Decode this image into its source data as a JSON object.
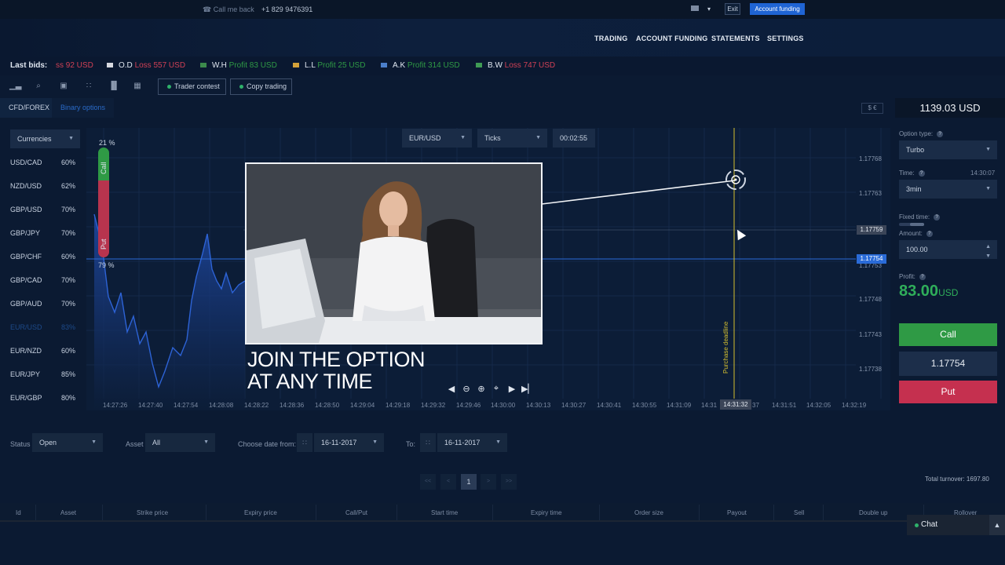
{
  "topbar": {
    "call_me_back": "Call me back",
    "phone": "+1 829 9476391",
    "exit_label": "Exit",
    "account_funding_label": "Account funding"
  },
  "nav": {
    "items": [
      "TRADING",
      "ACCOUNT FUNDING",
      "STATEMENTS",
      "SETTINGS"
    ]
  },
  "last_bids": {
    "label": "Last bids:",
    "items": [
      {
        "name": "",
        "result": "ss 92 USD",
        "type": "loss",
        "flag_color": "#5a6a82"
      },
      {
        "name": "O.D",
        "result": "Loss 557 USD",
        "type": "loss",
        "flag_color": "#d7d9e0"
      },
      {
        "name": "W.H",
        "result": "Profit 83 USD",
        "type": "profit",
        "flag_color": "#3c8a4c"
      },
      {
        "name": "L.L",
        "result": "Profit 25 USD",
        "type": "profit",
        "flag_color": "#d3a13a"
      },
      {
        "name": "A.K",
        "result": "Profit 314 USD",
        "type": "profit",
        "flag_color": "#4b7fcb"
      },
      {
        "name": "B.W",
        "result": "Loss 747 USD",
        "type": "loss",
        "flag_color": "#3f9b55"
      }
    ]
  },
  "toolbar": {
    "icons": [
      "chart-bar-icon",
      "search-chart-icon",
      "layout-icon",
      "indicator-icon",
      "bars-icon",
      "calendar-icon"
    ],
    "trader_contest": "Trader contest",
    "copy_trading": "Copy trading"
  },
  "tabs": {
    "cfd": "CFD/FOREX",
    "binary": "Binary options",
    "currency_switch": "$ €",
    "balance": "1139.03 USD"
  },
  "currencies": {
    "select": "Currencies",
    "pairs": [
      {
        "name": "USD/CAD",
        "pct": "60%"
      },
      {
        "name": "NZD/USD",
        "pct": "62%"
      },
      {
        "name": "GBP/USD",
        "pct": "70%"
      },
      {
        "name": "GBP/JPY",
        "pct": "70%"
      },
      {
        "name": "GBP/CHF",
        "pct": "60%"
      },
      {
        "name": "GBP/CAD",
        "pct": "70%"
      },
      {
        "name": "GBP/AUD",
        "pct": "70%"
      },
      {
        "name": "EUR/USD",
        "pct": "83%",
        "dim": true
      },
      {
        "name": "EUR/NZD",
        "pct": "60%"
      },
      {
        "name": "EUR/JPY",
        "pct": "85%"
      },
      {
        "name": "EUR/GBP",
        "pct": "80%"
      }
    ]
  },
  "chart": {
    "asset": "EUR/USD",
    "mode": "Ticks",
    "timer": "00:02:55",
    "call_pct": "21 %",
    "put_pct": "79 %",
    "call_label": "Call",
    "put_label": "Put",
    "price_labels": [
      "1.17768",
      "1.17763",
      "1.17753",
      "1.17748",
      "1.17743",
      "1.17738"
    ],
    "price_tag_grey": "1.17759",
    "price_tag_blue": "1.17754",
    "time_labels": [
      "14:27:26",
      "14:27:40",
      "14:27:54",
      "14:28:08",
      "14:28:22",
      "14:28:36",
      "14:28:50",
      "14:29:04",
      "14:29:18",
      "14:29:32",
      "14:29:46",
      "14:30:00",
      "14:30:13",
      "14:30:27",
      "14:30:41",
      "14:30:55",
      "14:31:09",
      "14:31",
      "37",
      "14:31:51",
      "14:32:05",
      "14:32:19"
    ],
    "time_highlight": "14:31:32",
    "deadline_label": "Purchase deadline",
    "colors": {
      "deadline": "#d4bf2f",
      "area": "#1b3f8c",
      "blue_line": "#2a6bd8"
    }
  },
  "video": {
    "caption_line1": "JOIN THE OPTION",
    "caption_line2": "AT ANY TIME"
  },
  "trade_panel": {
    "option_type_label": "Option type:",
    "option_type_value": "Turbo",
    "time_label": "Time:",
    "time_now": "14:30:07",
    "time_value": "3min",
    "fixed_time_label": "Fixed time:",
    "amount_label": "Amount:",
    "amount_value": "100.00",
    "profit_label": "Profit:",
    "profit_value": "83.00",
    "profit_currency": "USD",
    "call_label": "Call",
    "current_price": "1.17754",
    "put_label": "Put"
  },
  "filters": {
    "status_label": "Status",
    "status_value": "Open",
    "asset_label": "Asset",
    "asset_value": "All",
    "date_from_label": "Choose date from:",
    "date_from": "16-11-2017",
    "to_label": "To:",
    "date_to": "16-11-2017"
  },
  "pager": {
    "first": "<<",
    "prev": "<",
    "current": "1",
    "next": ">",
    "last": ">>",
    "turnover": "Total turnover: 1697.80"
  },
  "table": {
    "headers": [
      "Id",
      "Asset",
      "Strike price",
      "Expiry price",
      "Call/Put",
      "Start time",
      "Expiry time",
      "Order size",
      "Payout",
      "Sell",
      "Double up",
      "Rollover"
    ]
  },
  "chat": {
    "label": "Chat"
  }
}
